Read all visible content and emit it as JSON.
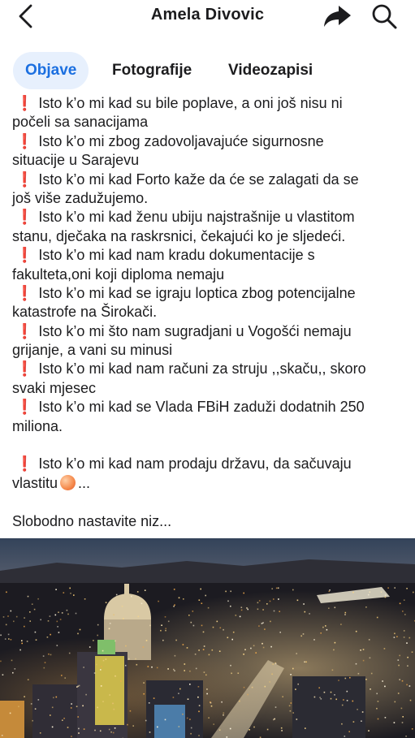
{
  "header": {
    "title": "Amela Divovic",
    "back_icon": "chevron-left-icon",
    "share_icon": "share-arrow-icon",
    "search_icon": "search-icon"
  },
  "tabs": [
    {
      "label": "Objave",
      "active": true
    },
    {
      "label": "Fotografije",
      "active": false
    },
    {
      "label": "Videozapisi",
      "active": false
    }
  ],
  "colors": {
    "accent": "#1b6fe0",
    "tab_active_bg": "#e7f0fd",
    "exclamation_red": "#e0262b",
    "text": "#1c1c1e"
  },
  "post": {
    "lines": [
      {
        "mark": "❗",
        "text": "Isto k’o mi kad su bile poplave, a oni još nisu ni"
      },
      {
        "mark": "",
        "text": "počeli sa sanacijama"
      },
      {
        "mark": "❗",
        "text": "Isto k’o mi zbog zadovoljavajuće sigurnosne"
      },
      {
        "mark": "",
        "text": "situacije u Sarajevu"
      },
      {
        "mark": "❗",
        "text": "Isto k’o mi kad Forto kaže da će se zalagati da se"
      },
      {
        "mark": "",
        "text": "još više zadužujemo."
      },
      {
        "mark": "❗",
        "text": "Isto k’o mi kad ženu ubiju najstrašnije u vlastitom"
      },
      {
        "mark": "",
        "text": "stanu, dječaka na raskrsnici, čekajući ko je sljedeći."
      },
      {
        "mark": "❗",
        "text": "Isto k’o mi kad nam kradu dokumentacije s"
      },
      {
        "mark": "",
        "text": "fakulteta,oni koji diploma nemaju"
      },
      {
        "mark": "❗",
        "text": "Isto k’o mi kad se igraju loptica zbog potencijalne"
      },
      {
        "mark": "",
        "text": "katastrofe na Širokači."
      },
      {
        "mark": "❗",
        "text": "Isto k’o mi što nam sugradjani u Vogošći nemaju"
      },
      {
        "mark": "",
        "text": "grijanje, a vani su minusi"
      },
      {
        "mark": "❗",
        "text": "Isto k’o mi kad nam računi za struju ,,skaču,, skoro"
      },
      {
        "mark": "",
        "text": "svaki mjesec"
      },
      {
        "mark": "❗",
        "text": "Isto k’o mi kad se Vlada FBiH zaduži dodatnih 250"
      },
      {
        "mark": "",
        "text": "miliona."
      }
    ],
    "last_line_a": "Isto k’o mi kad nam prodaju državu, da sačuvaju",
    "last_line_a_mark": "❗",
    "last_line_b": "vlastitu",
    "last_line_b_emoji": "peach-emoji",
    "last_line_b_suffix": "...",
    "closing": "Slobodno nastavite niz..."
  },
  "photo": {
    "description_icon": "city-night-photo"
  }
}
